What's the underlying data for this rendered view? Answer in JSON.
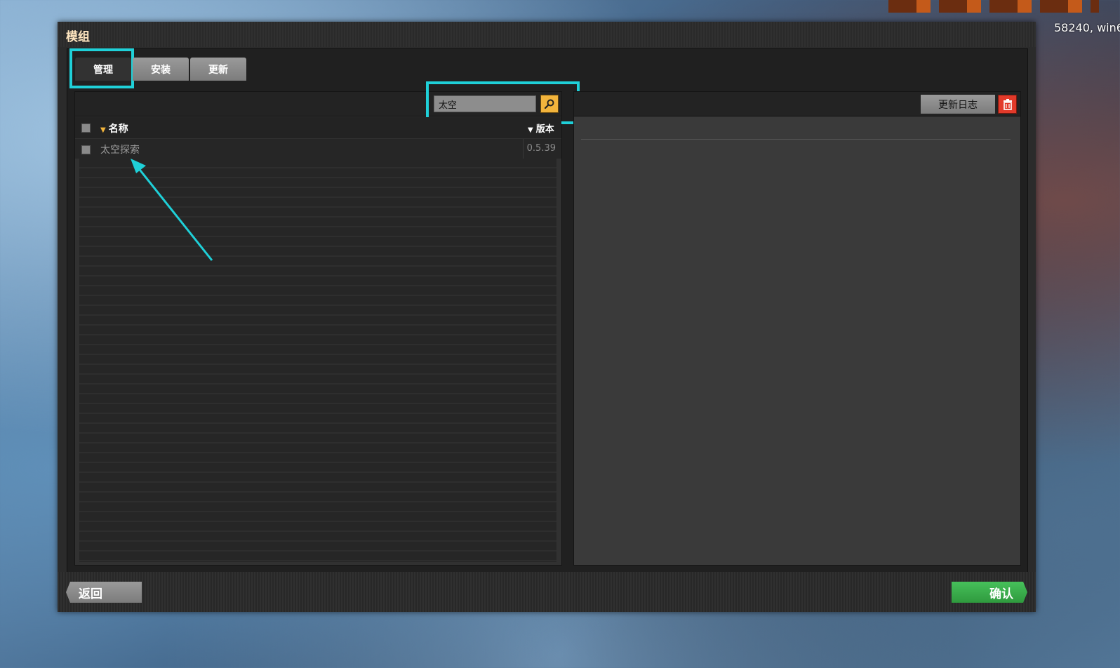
{
  "background": {
    "version_text": "58240, win6"
  },
  "window": {
    "title": "模组",
    "tabs": [
      {
        "label": "管理",
        "active": true
      },
      {
        "label": "安装",
        "active": false
      },
      {
        "label": "更新",
        "active": false
      }
    ]
  },
  "search": {
    "value": "太空",
    "button_icon": "search-icon"
  },
  "list": {
    "columns": {
      "name": "名称",
      "version": "版本"
    },
    "rows": [
      {
        "name": "太空探索",
        "version": "0.5.39",
        "checked": false
      }
    ]
  },
  "detail": {
    "changelog_label": "更新日志",
    "delete_icon": "trash-icon"
  },
  "footer": {
    "back_label": "返回",
    "confirm_label": "确认"
  },
  "colors": {
    "highlight": "#1fd0d8",
    "accent": "#f2b43c",
    "confirm": "#3aae4d",
    "delete": "#e23a2a"
  }
}
